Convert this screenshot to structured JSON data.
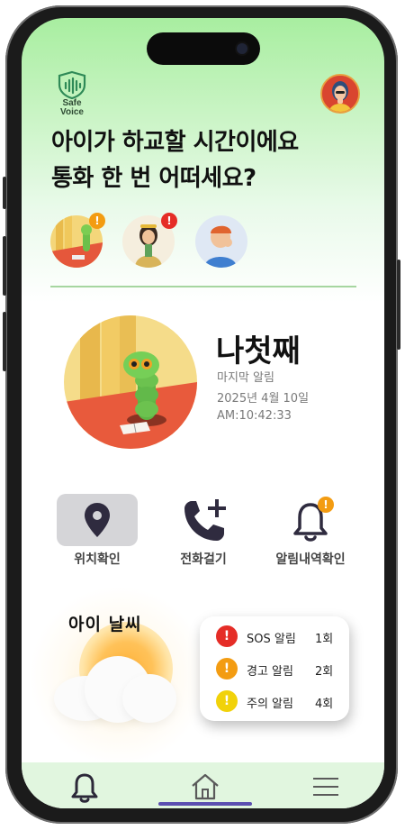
{
  "app": {
    "logo_line1": "Safe",
    "logo_line2": "Voice"
  },
  "header": {
    "headline_line1": "아이가 하교할 시간이에요",
    "headline_line2": "통화 한 번 어떠세요?"
  },
  "kids": [
    {
      "name": "caterpillar-kid",
      "badge": "!",
      "badge_color": "#f39c12"
    },
    {
      "name": "girl-kid",
      "badge": "!",
      "badge_color": "#e52d27"
    },
    {
      "name": "boy-kid",
      "badge": "",
      "badge_color": ""
    }
  ],
  "selected_child": {
    "name": "나첫째",
    "last_alert_label": "마지막 알림",
    "date": "2025년 4월 10일",
    "time": "AM:10:42:33"
  },
  "actions": [
    {
      "label": "위치확인",
      "icon": "location-pin-icon"
    },
    {
      "label": "전화걸기",
      "icon": "phone-plus-icon"
    },
    {
      "label": "알림내역확인",
      "icon": "bell-icon",
      "badge": "!"
    }
  ],
  "weather": {
    "title": "아이 날씨"
  },
  "alerts": [
    {
      "type": "SOS 알림",
      "count": "1회",
      "color": "#e52d27"
    },
    {
      "type": "경고 알림",
      "count": "2회",
      "color": "#f39c12"
    },
    {
      "type": "주의 알림",
      "count": "4회",
      "color": "#f1d20a"
    }
  ],
  "alert_symbol": "!",
  "tabbar": {
    "items": [
      "bell-icon",
      "home-icon",
      "menu-icon"
    ],
    "active": "home-icon"
  },
  "colors": {
    "accent": "#5b4fb0",
    "tab_bg": "#e1f6df",
    "header_green": "#a8eea0"
  }
}
